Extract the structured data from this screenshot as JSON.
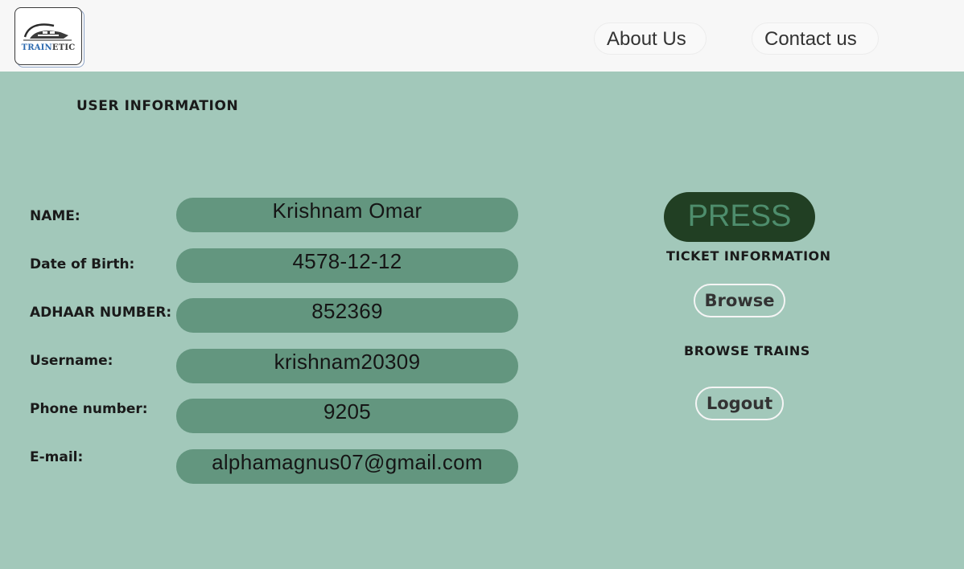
{
  "header": {
    "logo_text_a": "TRAIN",
    "logo_text_b": "ETIC",
    "nav": {
      "about": "About Us",
      "contact": "Contact us"
    }
  },
  "user_info": {
    "title": "USER INFORMATION",
    "fields": [
      {
        "label": "NAME:",
        "value": "Krishnam Omar"
      },
      {
        "label": "Date of Birth:",
        "value": "4578-12-12"
      },
      {
        "label": "ADHAAR NUMBER:",
        "value": "852369"
      },
      {
        "label": "Username:",
        "value": "krishnam20309"
      },
      {
        "label": "Phone number:",
        "value": "9205"
      },
      {
        "label": "E-mail:",
        "value": "alphamagnus07@gmail.com"
      }
    ]
  },
  "actions": {
    "press_label": "PRESS",
    "ticket_info_label": "TICKET INFORMATION",
    "browse_label": "Browse",
    "browse_trains_label": "BROWSE TRAINS",
    "logout_label": "Logout"
  },
  "colors": {
    "page_bg": "#a2c8ba",
    "header_bg": "#f7f7f7",
    "field_bg": "#63967f",
    "press_bg": "#213f23",
    "press_text": "#4e8d6c",
    "logo_blue": "#2e6bb0"
  },
  "icons": {
    "logo": "train-logo-icon"
  }
}
